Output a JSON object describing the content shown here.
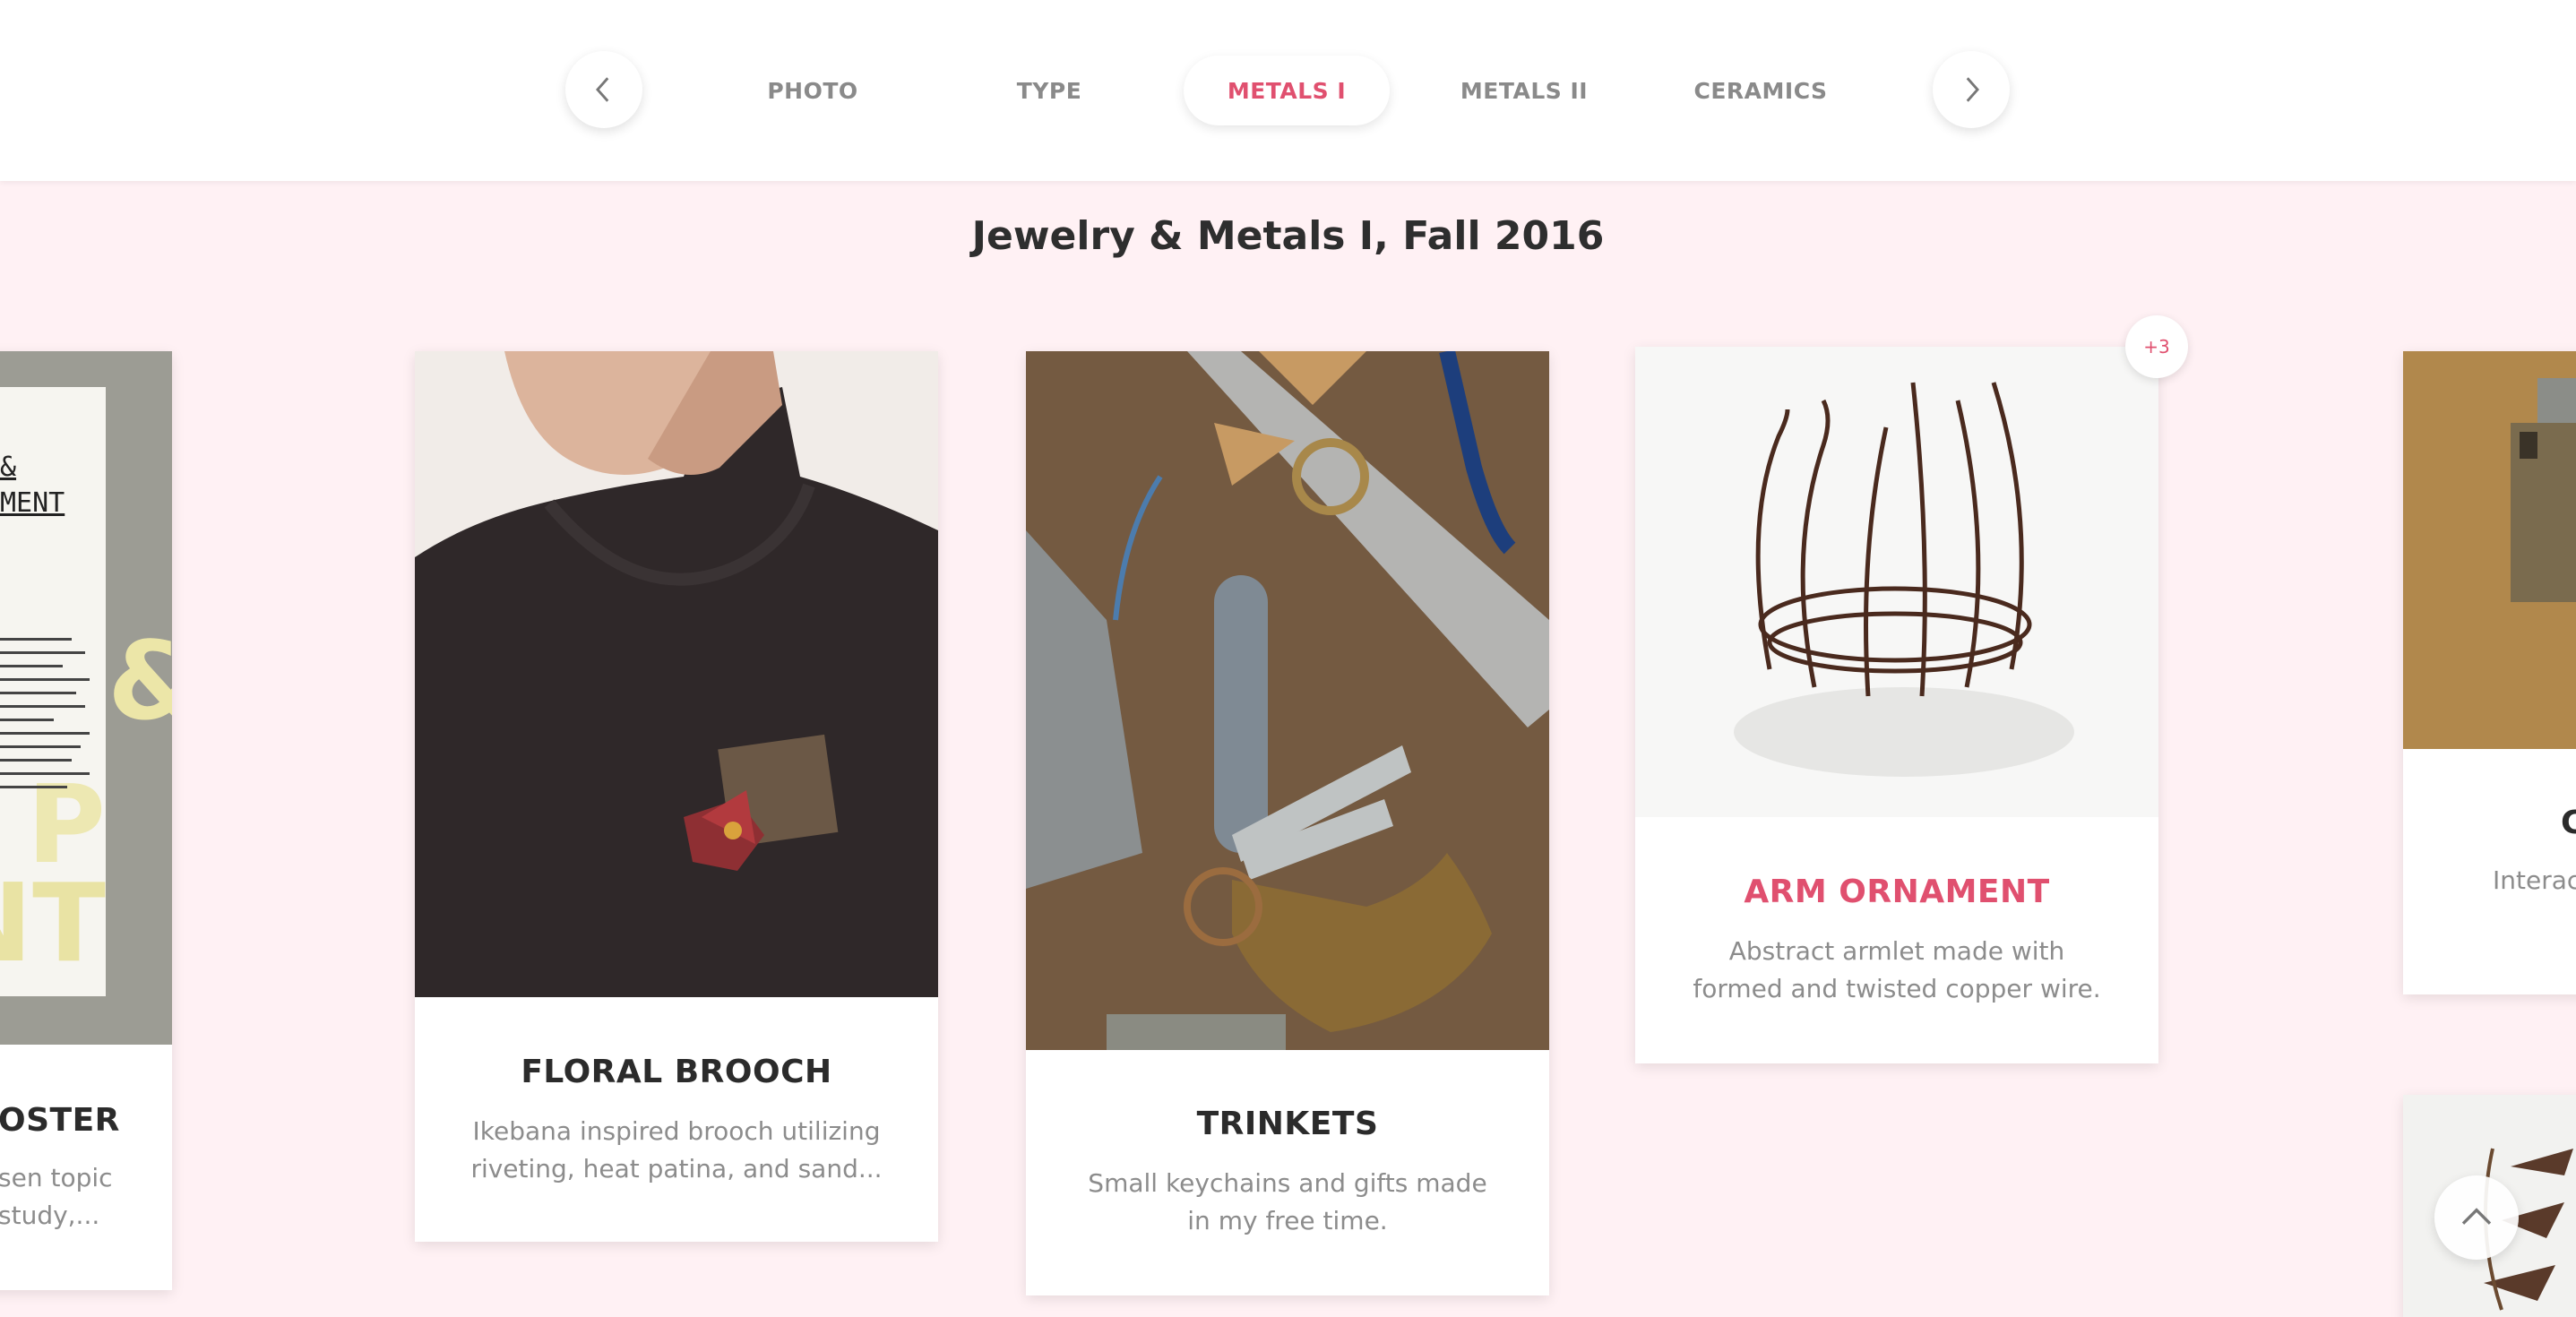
{
  "nav": {
    "tabs": [
      "PHOTO",
      "TYPE",
      "METALS I",
      "METALS II",
      "CERAMICS"
    ],
    "active_tab": "METALS I"
  },
  "section": {
    "title": "Jewelry & Metals I, Fall 2016"
  },
  "cards": {
    "poster": {
      "title": "OSTER",
      "desc": "sen topic study,...",
      "poster_lines": [
        "&",
        "MENT"
      ]
    },
    "floral": {
      "title": "FLORAL BROOCH",
      "desc": "Ikebana inspired brooch utilizing riveting, heat patina, and sand..."
    },
    "trinkets": {
      "title": "TRINKETS",
      "desc": "Small keychains and gifts made in my free time."
    },
    "arm": {
      "title": "ARM ORNAMENT",
      "desc": "Abstract armlet made with formed and twisted copper wire.",
      "badge": "+3"
    },
    "right": {
      "title": "C",
      "desc": "Interac"
    }
  },
  "colors": {
    "accent": "#e0506f",
    "page_bg": "#fff1f4",
    "text": "#2b2b2b",
    "muted": "#8c8c8c"
  },
  "icons": {
    "prev": "chevron-left-icon",
    "next": "chevron-right-icon",
    "scroll_top": "chevron-up-icon"
  }
}
